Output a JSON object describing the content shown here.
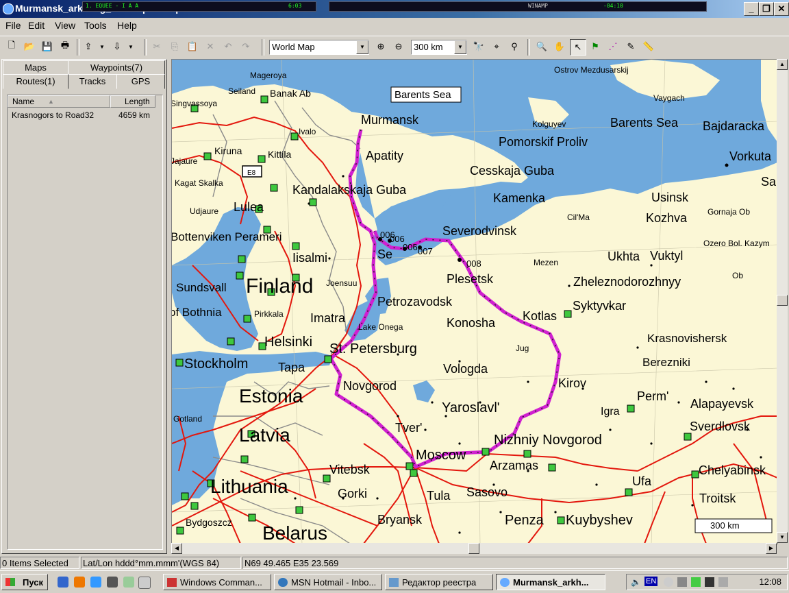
{
  "window": {
    "title": "Murmansk_arkhang_kirovmps - MapSource",
    "winamp_title": "WINAMP",
    "winamp_track": "1. EQUEE - I A A",
    "winamp_time": "6:03",
    "winamp_elapsed": "-04:10"
  },
  "menu": [
    "File",
    "Edit",
    "View",
    "Tools",
    "Help"
  ],
  "toolbar": {
    "map_select": "World Map",
    "zoom_scale": "300 km"
  },
  "left_panel": {
    "tabs_row1": [
      "Maps",
      "Waypoints(7)"
    ],
    "tabs_row2": [
      "Routes(1)",
      "Tracks",
      "GPS"
    ],
    "columns": {
      "name": "Name",
      "length": "Length"
    },
    "routes": [
      {
        "name": "Krasnogors to Road32",
        "length": "4659 km"
      }
    ]
  },
  "map": {
    "scale_label": "300 km",
    "highway_shield": "E8",
    "colors": {
      "water": "#6fa9dc",
      "land": "#fbf7d6",
      "road": "#e3170d",
      "route": "#d020d0",
      "border": "#8a8a8a",
      "poi": "#3ec83e"
    },
    "sea_labels": [
      "Barents Sea",
      "Barents Sea",
      "Pomorskif Proliv",
      "Cesskaja Guba",
      "Kandalakskaja Guba",
      "Bottenviken Perameri",
      "of Bothnia",
      "Lake Onega"
    ],
    "big_labels": [
      "Finland",
      "Estonia",
      "Latvia",
      "Lithuania",
      "Belarus"
    ],
    "city_labels": [
      "Murmansk",
      "Apatity",
      "Severodvinsk",
      "Plesetsk",
      "Petrozavodsk",
      "Konosha",
      "Kotlas",
      "St. Petersburg",
      "Vologda",
      "Novgorod",
      "Kirov",
      "Yaroslavl'",
      "Tver'",
      "Moscow",
      "Nizhniy Novgorod",
      "Arzamas",
      "Perm'",
      "Sverdlovsk",
      "Chelyabinsk",
      "Ufa",
      "Troitsk",
      "Kuybyshev",
      "Penza",
      "Sasovo",
      "Tula",
      "Bryansk",
      "Gorki",
      "Vitebsk",
      "Helsinki",
      "Stockholm",
      "Tapa",
      "Imatra",
      "Pirkkala",
      "Iisalmi",
      "Joensuu",
      "Lulea",
      "Sundsvall",
      "Kiruna",
      "Kittila",
      "Ivalo",
      "Banak Ab",
      "Seiland",
      "Mageroya",
      "Vorkuta",
      "Usinsk",
      "Kozhva",
      "Ukhta",
      "Vuktyl",
      "Zheleznodorozhnyy",
      "Syktyvkar",
      "Krasnovishersk",
      "Berezniki",
      "Alapayevsk",
      "Igra",
      "Kamenka",
      "Kolguyev",
      "Bajdaracka",
      "Sa",
      "Bydgoszcz",
      "Jug",
      "Mezen",
      "Cil'Ma",
      "Gornaja Ob",
      "Ozero Bol. Kazym",
      "Ob",
      "Ostrov Mezdusarskij",
      "Vaygach",
      "Singvassoya",
      "Jajaure",
      "Kagat Skalka",
      "Udjaure",
      "Gotland",
      "Se"
    ],
    "waypoint_labels": [
      "006",
      "006",
      "006",
      "007",
      "008"
    ]
  },
  "statusbar": {
    "selection": "0 Items Selected",
    "format": "Lat/Lon hddd°mm.mmm'(WGS 84)",
    "position": "N69 49.465 E35 23.569"
  },
  "taskbar": {
    "start_label": "Пуск",
    "tasks": [
      "Windows Comman...",
      "MSN Hotmail - Inbo...",
      "Редактор реестра",
      "Murmansk_arkh..."
    ],
    "tray_lang": "EN",
    "clock": "12:08"
  }
}
